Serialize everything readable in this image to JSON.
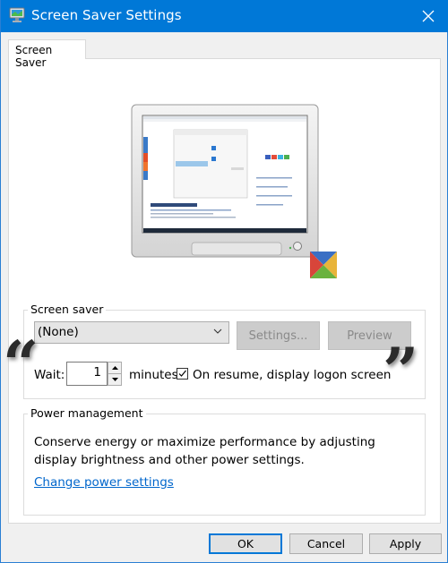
{
  "window": {
    "title": "Screen Saver Settings",
    "icon": "monitor-settings-icon",
    "close_icon": "close-icon"
  },
  "tabs": [
    {
      "label": "Screen Saver",
      "active": true
    }
  ],
  "preview_monitor": {
    "description": "monitor-preview-image",
    "badge_icon": "windows-club-logo-icon",
    "badge_colors": [
      "#3b6fc4",
      "#e8b43a",
      "#6ab23e",
      "#d8453a"
    ]
  },
  "screen_saver_group": {
    "legend": "Screen saver",
    "dropdown": {
      "selected": "(None)"
    },
    "settings_button": "Settings...",
    "preview_button": "Preview",
    "wait_label": "Wait:",
    "wait_value": "1",
    "minutes_label": "minutes",
    "logon_checkbox": {
      "label": "On resume, display logon screen",
      "checked": true
    }
  },
  "decorations": {
    "open_quote": "“",
    "close_quote": "”"
  },
  "power_group": {
    "legend": "Power management",
    "description": "Conserve energy or maximize performance by adjusting display brightness and other power settings.",
    "link": "Change power settings"
  },
  "footer": {
    "ok": "OK",
    "cancel": "Cancel",
    "apply": "Apply"
  },
  "colors": {
    "titlebar": "#0078d7",
    "link": "#0066cc",
    "disabled_button": "#cccccc"
  }
}
